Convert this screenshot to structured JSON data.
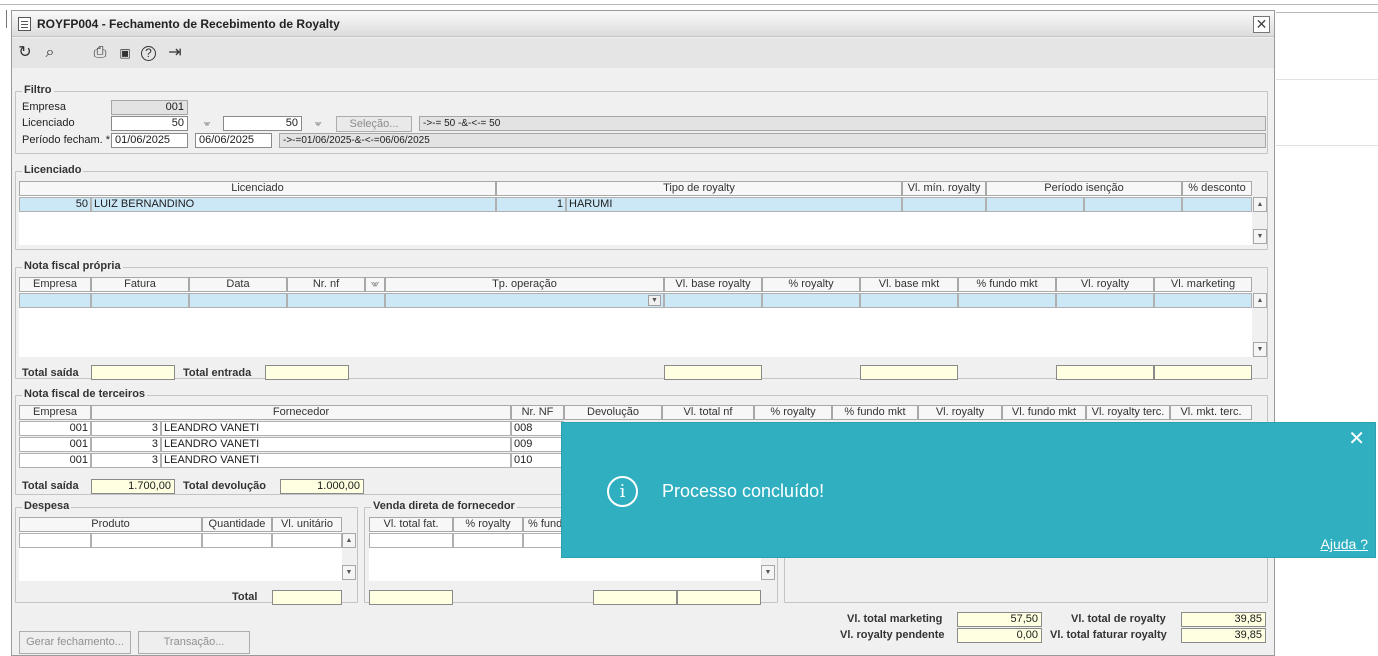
{
  "window": {
    "title": "ROYFP004 - Fechamento de Recebimento de Royalty",
    "close_glyph": "✕"
  },
  "toolbar": [
    {
      "name": "refresh-icon",
      "glyph": "↻"
    },
    {
      "name": "search-icon",
      "glyph": "⌕"
    },
    {
      "name": "print-icon",
      "glyph": "⎙"
    },
    {
      "name": "calendar-icon",
      "glyph": "▣"
    },
    {
      "name": "help-icon",
      "glyph": "?"
    },
    {
      "name": "exit-icon",
      "glyph": "⇥"
    }
  ],
  "filtro": {
    "legend": "Filtro",
    "empresa_label": "Empresa",
    "empresa_value": "001",
    "licenciado_label": "Licenciado",
    "licenciado_from": "50",
    "licenciado_to": "50",
    "selecao_button": "Seleção...",
    "licenciado_expr": "->-= 50 -&-<-= 50",
    "periodo_label": "Período fecham. *",
    "periodo_from": "01/06/2025",
    "periodo_to": "06/06/2025",
    "periodo_expr": "->-=01/06/2025-&-<-=06/06/2025"
  },
  "licenciado": {
    "legend": "Licenciado",
    "headers": [
      "Licenciado",
      "Tipo de royalty",
      "Vl. mín. royalty",
      "Período isenção",
      "% desconto"
    ],
    "row": {
      "cod": "50",
      "nome": "LUIZ BERNANDINO",
      "tipo_cod": "1",
      "tipo": "HARUMI"
    }
  },
  "nf_propria": {
    "legend": "Nota fiscal própria",
    "headers": [
      "Empresa",
      "Fatura",
      "Data",
      "Nr. nf",
      "Tp. operação",
      "Vl. base royalty",
      "% royalty",
      "Vl. base mkt",
      "% fundo mkt",
      "Vl. royalty",
      "Vl. marketing"
    ],
    "total_saida": "Total saída",
    "total_entrada": "Total entrada"
  },
  "nf_terceiros": {
    "legend": "Nota fiscal de terceiros",
    "headers": [
      "Empresa",
      "Fornecedor",
      "Nr. NF",
      "Devolução",
      "Vl. total nf",
      "% royalty",
      "% fundo mkt",
      "Vl. royalty",
      "Vl. fundo mkt",
      "Vl. royalty terc.",
      "Vl. mkt. terc."
    ],
    "rows": [
      {
        "empresa": "001",
        "cod": "3",
        "fornecedor": "LEANDRO VANETI",
        "nf": "008"
      },
      {
        "empresa": "001",
        "cod": "3",
        "fornecedor": "LEANDRO VANETI",
        "nf": "009"
      },
      {
        "empresa": "001",
        "cod": "3",
        "fornecedor": "LEANDRO VANETI",
        "nf": "010"
      }
    ],
    "total_saida_label": "Total saída",
    "total_saida": "1.700,00",
    "total_devolucao_label": "Total devolução",
    "total_devolucao": "1.000,00"
  },
  "despesa": {
    "legend": "Despesa",
    "headers": [
      "Produto",
      "Quantidade",
      "Vl. unitário"
    ],
    "total_label": "Total"
  },
  "venda_direta": {
    "legend": "Venda direta de fornecedor",
    "headers": [
      "Vl. total fat.",
      "% royalty",
      "% fundo"
    ]
  },
  "totais": {
    "vl_total_marketing_label": "Vl. total marketing",
    "vl_total_marketing": "57,50",
    "vl_total_royalty_label": "Vl. total de royalty",
    "vl_total_royalty": "39,85",
    "vl_royalty_pendente_label": "Vl. royalty pendente",
    "vl_royalty_pendente": "0,00",
    "vl_total_faturar_label": "Vl. total faturar royalty",
    "vl_total_faturar": "39,85"
  },
  "buttons": {
    "gerar": "Gerar fechamento...",
    "transacao": "Transação..."
  },
  "toast": {
    "message": "Processo concluído!",
    "help": "Ajuda ?",
    "close": "✕",
    "info": "i"
  },
  "colors": {
    "toast": "#30afc0",
    "selected_row": "#cce8f7",
    "total_field": "#ffffe1"
  }
}
